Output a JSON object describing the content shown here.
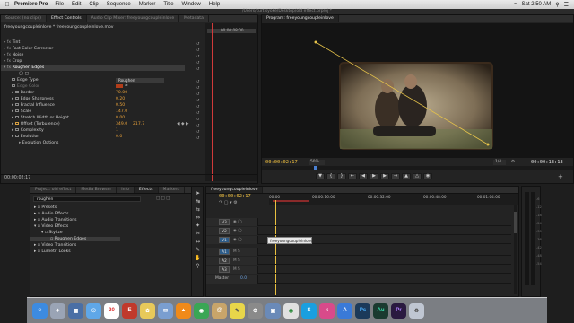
{
  "menubar": {
    "app": "Premiere Pro",
    "items": [
      "File",
      "Edit",
      "Clip",
      "Sequence",
      "Marker",
      "Title",
      "Window",
      "Help"
    ],
    "time": "Sat 2:50 AM"
  },
  "path_bar": "/Users/curtisyoke/Desktop/old effect.prproj *",
  "effect_controls": {
    "tabs": [
      "Source: (no clips)",
      "Effect Controls",
      "Audio Clip Mixer: freeyoungcoupleinlove",
      "Metadata"
    ],
    "clip_name": "freeyoungcoupleinlove * freeyoungcoupleinlove.mov",
    "timecode_ruler": "00:00:08:00",
    "effects": [
      "Tint",
      "Fast Color Corrector",
      "Noise",
      "Crop",
      "Roughen Edges"
    ],
    "properties": [
      {
        "label": "Edge Type",
        "value": "Roughen"
      },
      {
        "label": "Edge Color",
        "value": ""
      },
      {
        "label": "Border",
        "value": "70.00"
      },
      {
        "label": "Edge Sharpness",
        "value": "0.20"
      },
      {
        "label": "Fractal Influence",
        "value": "0.50"
      },
      {
        "label": "Scale",
        "value": "147.0"
      },
      {
        "label": "Stretch Width or Height",
        "value": "0.00"
      },
      {
        "label": "Offset (Turbulence)",
        "value": "349.0",
        "value2": "217.7"
      },
      {
        "label": "Complexity",
        "value": "1"
      },
      {
        "label": "Evolution",
        "value": "0.0"
      },
      {
        "label": "Evolution Options",
        "value": ""
      }
    ],
    "current_time": "00:00:02:17"
  },
  "program": {
    "tab": "Program: freeyoungcoupleinlove",
    "current_time": "00:00:02:17",
    "zoom": "50%",
    "resolution": "1/4",
    "duration": "00:00:13:13"
  },
  "project": {
    "tabs": [
      "Project: old effect",
      "Media Browser",
      "Info",
      "Effects",
      "Markers"
    ],
    "search_value": "roughen",
    "tree": [
      {
        "label": "Presets",
        "level": 0
      },
      {
        "label": "Audio Effects",
        "level": 0
      },
      {
        "label": "Audio Transitions",
        "level": 0
      },
      {
        "label": "Video Effects",
        "level": 0
      },
      {
        "label": "Stylize",
        "level": 1
      },
      {
        "label": "Roughen Edges",
        "level": 2
      },
      {
        "label": "Video Transitions",
        "level": 0
      },
      {
        "label": "Lumetri Looks",
        "level": 0
      }
    ]
  },
  "timeline": {
    "tab": "freeyoungcoupleinlove",
    "current_time": "00:00:02:17",
    "ruler": [
      "00:00",
      "00:00:16:00",
      "00:00:32:00",
      "00:00:48:00",
      "00:01:04:00"
    ],
    "video_tracks": [
      "V3",
      "V2",
      "V1"
    ],
    "audio_tracks": [
      "A1",
      "A2",
      "A3"
    ],
    "master_label": "Master",
    "master_value": "0.0",
    "clip_label": "freeyoungcoupleinlove"
  },
  "dock": [
    "Finder",
    "Launchpad",
    "Mission Control",
    "Safari",
    "Calendar",
    "Express",
    "Photos",
    "Mail",
    "VLC",
    "FaceTime",
    "Contacts",
    "Stickies",
    "Settings",
    "Preview",
    "Chrome",
    "Skype",
    "Music",
    "App Store",
    "Photoshop",
    "Audition",
    "Premiere",
    "Trash"
  ]
}
